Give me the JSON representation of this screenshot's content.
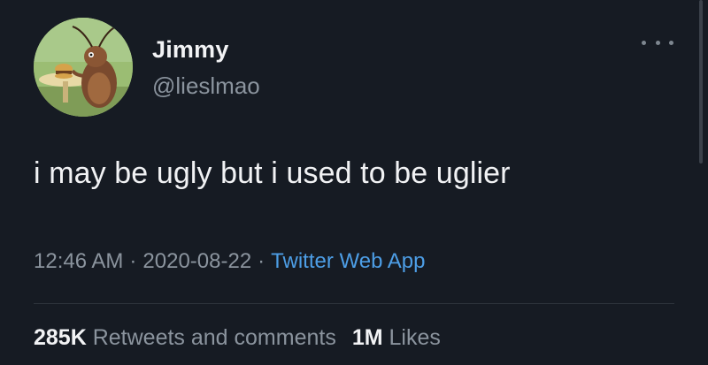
{
  "tweet": {
    "author": {
      "display_name": "Jimmy",
      "handle": "@lieslmao",
      "avatar_icon": "cartoon-cockroach-avatar"
    },
    "menu_icon": "more-dots-icon",
    "text": "i may be ugly but i used to be uglier",
    "meta": {
      "time": "12:46 AM",
      "separator": "·",
      "date": "2020-08-22",
      "source": "Twitter Web App"
    },
    "stats": {
      "retweets_count": "285K",
      "retweets_label": "Retweets and comments",
      "likes_count": "1M",
      "likes_label": "Likes"
    }
  },
  "colors": {
    "background": "#161b23",
    "primary_text": "#f1f2f4",
    "secondary_text": "#8b949e",
    "link": "#4d9ee6"
  }
}
